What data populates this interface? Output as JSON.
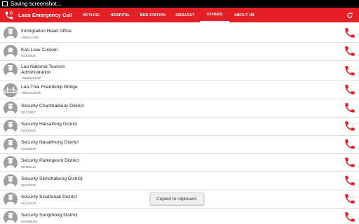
{
  "status_bar": {
    "text": "Saving screenshot..."
  },
  "app": {
    "title": "Laos Emergency Call",
    "accent_color": "#e31e24"
  },
  "tabs": [
    {
      "label": "HOTLINE"
    },
    {
      "label": "HOSPITAL"
    },
    {
      "label": "BUS STATION"
    },
    {
      "label": "EMBASSY"
    },
    {
      "label": "OTHERS",
      "active": true
    },
    {
      "label": "ABOUT US"
    }
  ],
  "contacts": [
    {
      "name": "Immigration Head Office",
      "phone": "+8562121250",
      "avatar": "officer-icon"
    },
    {
      "name": "Kao Liew Custom",
      "phone": "021670846",
      "avatar": "person-icon"
    },
    {
      "name": "Lao National Tourism Administration",
      "phone": "+85621212248",
      "avatar": "officer-icon"
    },
    {
      "name": "Lao-Thai Friendship Bridge",
      "phone": "+85621812248",
      "avatar": "bridge-icon"
    },
    {
      "name": "Security Chanthabouly District",
      "phone": "021212807",
      "avatar": "officer-icon"
    },
    {
      "name": "Security Hatsaifong District",
      "phone": "021812062",
      "avatar": "officer-icon"
    },
    {
      "name": "Security Nasaithong District",
      "phone": "021822016",
      "avatar": "officer-icon"
    },
    {
      "name": "Security Parkngeum District",
      "phone": "021860412",
      "avatar": "officer-icon"
    },
    {
      "name": "Security Sikhottabong District",
      "phone": "021212712",
      "avatar": "officer-icon"
    },
    {
      "name": "Security Sisattanak District",
      "phone": "021212233",
      "avatar": "officer-icon"
    },
    {
      "name": "Security Sungthong District",
      "phone": "0209966166",
      "avatar": "officer-icon"
    }
  ],
  "toast": {
    "text": "Copied to clipboard."
  }
}
